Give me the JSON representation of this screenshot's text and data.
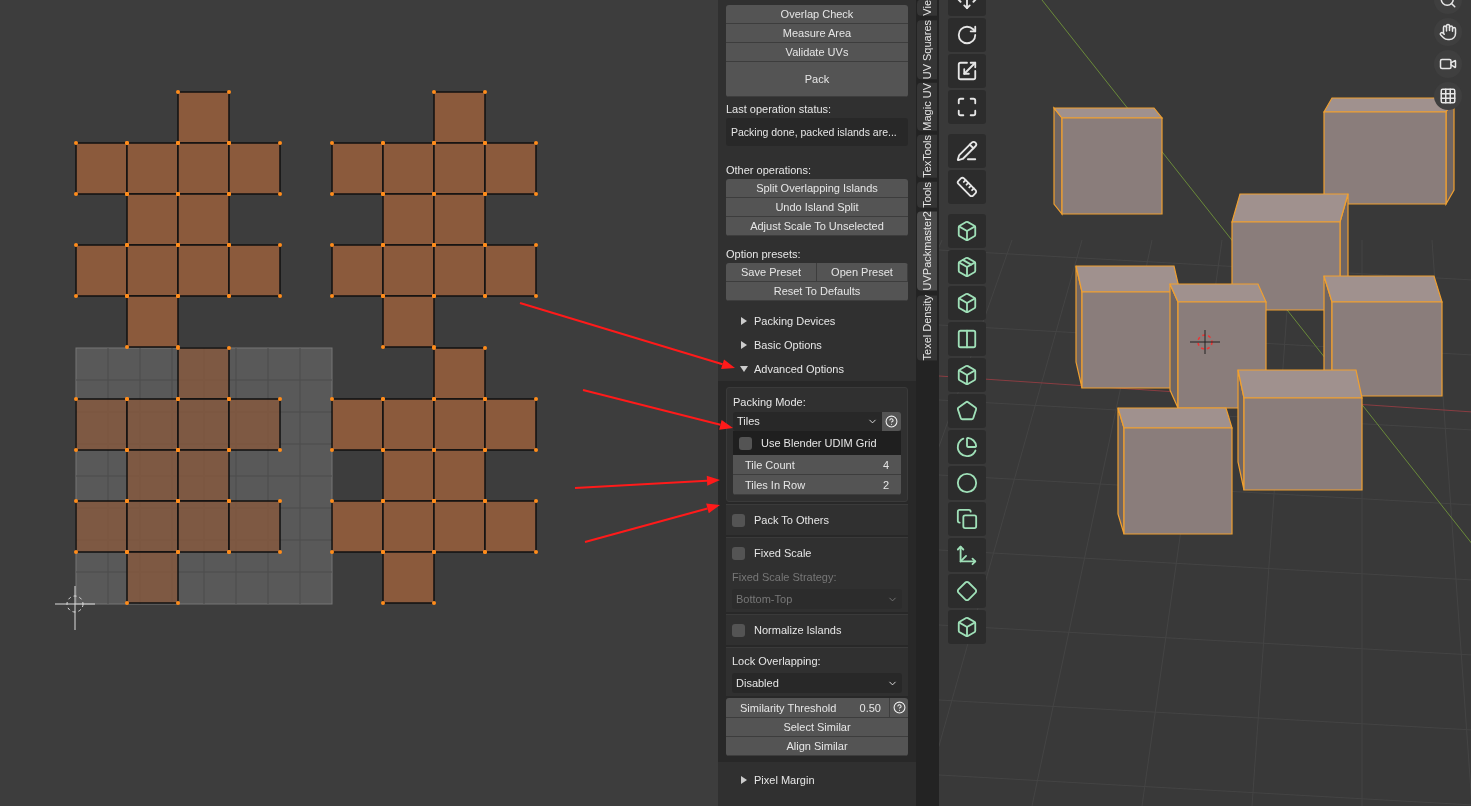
{
  "panel": {
    "top_buttons": [
      "Overlap Check",
      "Measure Area",
      "Validate UVs"
    ],
    "pack_button": "Pack",
    "status_label": "Last operation status:",
    "status_text": "Packing done, packed islands are...",
    "other_label": "Other operations:",
    "other_buttons": [
      "Split Overlapping Islands",
      "Undo Island Split",
      "Adjust Scale To Unselected"
    ],
    "presets_label": "Option presets:",
    "preset_buttons": [
      "Save Preset",
      "Open Preset"
    ],
    "reset_button": "Reset To Defaults",
    "sections": [
      {
        "label": "Packing Devices",
        "expanded": false
      },
      {
        "label": "Basic Options",
        "expanded": false
      },
      {
        "label": "Advanced Options",
        "expanded": true
      },
      {
        "label": "Pixel Margin",
        "expanded": false
      }
    ],
    "advanced": {
      "packing_mode_label": "Packing Mode:",
      "packing_mode": "Tiles",
      "udim": {
        "label": "Use Blender UDIM Grid",
        "checked": false
      },
      "tile_fields": [
        {
          "label": "Tile Count",
          "value": "4"
        },
        {
          "label": "Tiles In Row",
          "value": "2"
        }
      ],
      "boxes": [
        [
          {
            "kind": "checkbox",
            "label": "Pack To Others",
            "checked": false
          }
        ],
        [
          {
            "kind": "checkbox",
            "label": "Fixed Scale",
            "checked": false
          },
          {
            "kind": "label",
            "label": "Fixed Scale Strategy:",
            "disabled": true
          },
          {
            "kind": "dropdown",
            "value": "Bottom-Top",
            "disabled": true
          }
        ],
        [
          {
            "kind": "checkbox",
            "label": "Normalize Islands",
            "checked": false
          }
        ],
        [
          {
            "kind": "label",
            "label": "Lock Overlapping:",
            "disabled": false
          },
          {
            "kind": "dropdown",
            "value": "Disabled",
            "disabled": false
          }
        ]
      ],
      "similarity": {
        "label": "Similarity Threshold",
        "value": "0.50"
      },
      "similar_buttons": [
        "Select Similar",
        "Align Similar"
      ]
    }
  },
  "tabs": [
    {
      "label": "Vie",
      "selected": false
    },
    {
      "label": "UV Squares",
      "selected": false
    },
    {
      "label": "Magic UV",
      "selected": false
    },
    {
      "label": "TexTools",
      "selected": false
    },
    {
      "label": "Tools",
      "selected": false
    },
    {
      "label": "UVPackmaster2",
      "selected": true
    },
    {
      "label": "Texel Density",
      "selected": false
    }
  ]
}
